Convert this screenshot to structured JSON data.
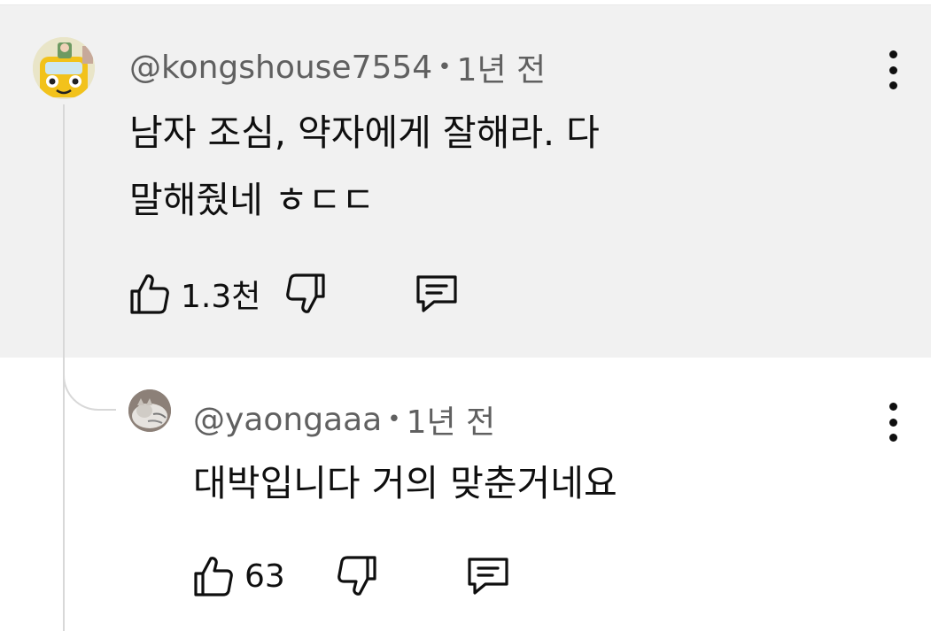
{
  "comments": [
    {
      "author": "@kongshouse7554",
      "time": "1년 전",
      "text_line1": "남자 조심, 약자에게 잘해라. 다",
      "text_line2": "말해줬네 ㅎㄷㄷ",
      "like_count": "1.3천",
      "avatar_icon": "cartoon-bus-avatar"
    },
    {
      "author": "@yaongaaa",
      "time": "1년 전",
      "text": "대박입니다 거의 맞춘거네요",
      "like_count": "63",
      "avatar_icon": "cat-photo-avatar"
    }
  ],
  "separator": "•",
  "icons": {
    "like": "thumbs-up-icon",
    "dislike": "thumbs-down-icon",
    "reply": "reply-comment-icon",
    "more": "more-vertical-icon"
  },
  "colors": {
    "highlight_bg": "#f1f1f1",
    "meta_text": "#606060",
    "body_text": "#0f0f0f",
    "thread_line": "#d8d8d8"
  }
}
